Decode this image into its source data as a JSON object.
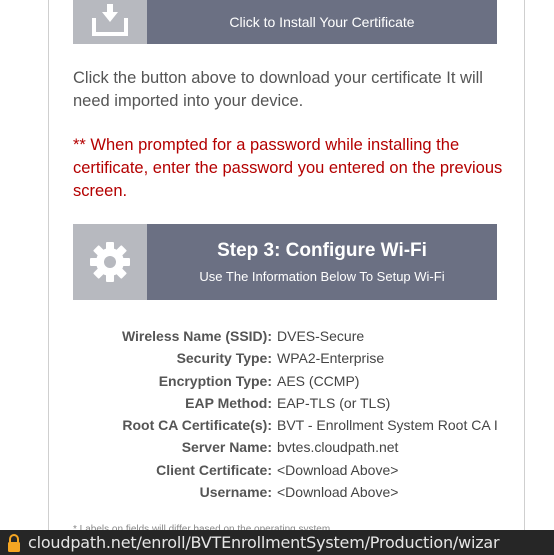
{
  "install": {
    "button_label": "Click to Install Your Certificate",
    "icon": "download-tray-icon"
  },
  "instructions": "Click the button above to download your certificate It will need imported into your device.",
  "warning": "** When prompted for a password while installing the certificate, enter the password you entered on the previous screen.",
  "step3": {
    "title": "Step 3: Configure Wi-Fi",
    "subtitle": "Use The Information Below To Setup Wi-Fi",
    "icon": "gear-icon"
  },
  "wifi_info": [
    {
      "label": "Wireless Name (SSID):",
      "value": "DVES-Secure"
    },
    {
      "label": "Security Type:",
      "value": "WPA2-Enterprise"
    },
    {
      "label": "Encryption Type:",
      "value": "AES (CCMP)"
    },
    {
      "label": "EAP Method:",
      "value": "EAP-TLS (or TLS)"
    },
    {
      "label": "Root CA Certificate(s):",
      "value": "BVT - Enrollment System Root CA I"
    },
    {
      "label": "Server Name:",
      "value": "bvtes.cloudpath.net"
    },
    {
      "label": "Client Certificate:",
      "value": "<Download Above>"
    },
    {
      "label": "Username:",
      "value": "<Download Above>"
    }
  ],
  "footnote": "* Labels on fields will differ based on the operating system",
  "url_bar": {
    "url": "cloudpath.net/enroll/BVTEnrollmentSystem/Production/wizar",
    "icon": "lock-icon"
  },
  "colors": {
    "bar": "#6b7083",
    "icon_box": "#b7b9bf",
    "warning": "#b40000",
    "url_bar_bg": "#262626",
    "lock": "#f5a623"
  }
}
